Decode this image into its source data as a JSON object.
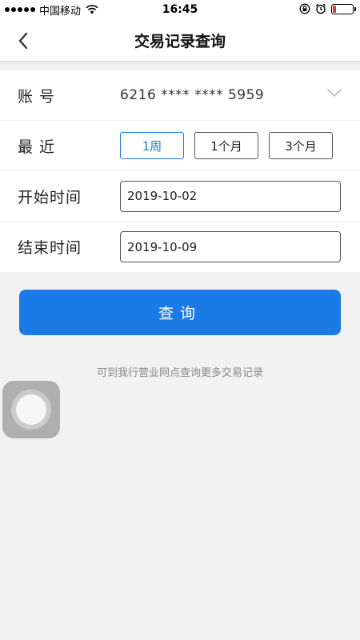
{
  "status_bar": {
    "carrier": "中国移动",
    "time": "16:45"
  },
  "nav": {
    "title": "交易记录查询"
  },
  "form": {
    "account": {
      "label": "账 号",
      "value": "6216 **** **** 5959"
    },
    "recent": {
      "label": "最 近",
      "options": [
        "1周",
        "1个月",
        "3个月"
      ],
      "selected": "1周"
    },
    "start_date": {
      "label": "开始时间",
      "value": "2019-10-02"
    },
    "end_date": {
      "label": "结束时间",
      "value": "2019-10-09"
    }
  },
  "query_button": {
    "label": "查询"
  },
  "hint": "可到我行营业网点查询更多交易记录",
  "colors": {
    "accent": "#1a7ae6",
    "background": "#f2f2f2",
    "battery_low": "#e53935"
  },
  "icons": {
    "back": "chevron-left-icon",
    "dropdown": "chevron-down-icon",
    "wifi": "wifi-icon",
    "lock_rotation": "rotation-lock-icon",
    "alarm": "alarm-icon",
    "battery": "battery-icon"
  }
}
